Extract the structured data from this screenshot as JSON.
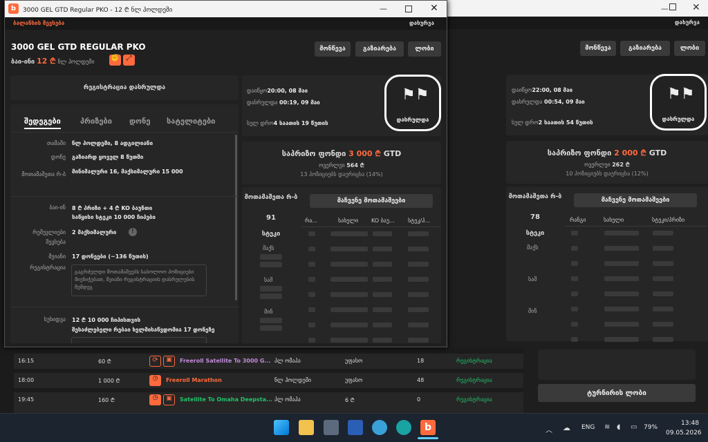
{
  "window": {
    "title": "3000 GEL GTD Regular PKO - 12 ₾ ნლ ჰოლდემი"
  },
  "back_window": {
    "close": "დახურვა",
    "buttons": [
      "მონწევა",
      "გაზიარება",
      "ლობი"
    ],
    "date_label": "დაიწყო",
    "date_value": "22:00, 08 მაი",
    "end_label": "დასრულდა",
    "end_value": "00:54, 09 მაი",
    "total_label": "სულ დრო",
    "total_value": "2 საათის 54 წუთის",
    "finished_badge": "დასრულდა",
    "prize_pool_label": "საპრიზო ფონდი",
    "prize_pool_value": "2 000 ₾",
    "prize_pool_suffix": "GTD",
    "overlay_label": "ოვერლეი",
    "overlay_value": "262 ₾",
    "overlay_note": "10 პოზიციებს დაერიცხა (12%)",
    "players_label": "მოთამაშეთა რ-ბ",
    "players_value": "78",
    "stack_label": "სტეკი",
    "show_players": "მაჩვენე მოთამაშეები",
    "cols": [
      "რანგი",
      "სახელი",
      "სტეკი/პრიზი"
    ],
    "stack_rows": [
      "მაქს",
      "საშ",
      "მინ"
    ],
    "lobby_button": "ტურნირის ლობი"
  },
  "front_window": {
    "balance": "ბალანსის შევსება",
    "close": "დახურვა",
    "title": "3000 GEL GTD REGULAR PKO",
    "buyin_label": "ბაი-ინი",
    "buyin_value": "12 ₾",
    "game_type": "ნლ ჰოლდემი",
    "buttons": [
      "მონწევა",
      "გაზიარება",
      "ლობი"
    ],
    "registration_closed": "რეგისტრაცია დასრულდა",
    "tabs": [
      "შედეგები",
      "პრიზები",
      "დონე",
      "სატელიტები"
    ],
    "info": [
      {
        "k": "თამაში",
        "v": "ნლ ჰოლდემი, 8 ადგილიანი"
      },
      {
        "k": "დონე",
        "v": "გაზიარდ ყოველ 8 წუთში"
      },
      {
        "k": "მოთამაშეთა რ-ბ",
        "v": "მინიმალური 16, მაქსიმალური 15 000"
      },
      {
        "k": "ბაი-ინ",
        "v": "8 ₾ პრიზი + 4 ₾ KO ბაუნთი"
      },
      {
        "k": "",
        "v": "საწყისი სტეკი 10 000 ჩიპები"
      },
      {
        "k": "რეშევლიები",
        "v": "2 მაქსიმალური"
      },
      {
        "k": "მეიანი",
        "v": "17 დონეები (~136 წუთის)"
      },
      {
        "k": "სუხიდვა",
        "v": "12 ₾ 10 000 ჩიპისთვის"
      }
    ],
    "rebuy_sub": "შევსება",
    "reg_label": "რეგისტრაცია",
    "late_reg_note": "გაგრძელდი მოთამაშეებს საბოლოო პოზიციები მიენიჭებათ, შეიანი რეგისტრაციის დასრულების შემდეგ",
    "rebuy_line": "შესაძლებელი რებაი ხელმისაწვდომია 17 დონეზე",
    "date_label": "დაიწყო",
    "date_value": "20:00, 08 მაი",
    "end_label": "დასრულდა",
    "end_value": "00:19, 09 მაი",
    "total_label": "სულ დრო",
    "total_value": "4 საათის 19 წუთის",
    "finished_badge": "დასრულდა",
    "prize_pool_label": "საპრიზო ფონდი",
    "prize_pool_value": "3 000 ₾",
    "prize_pool_suffix": "GTD",
    "overlay_label": "ოვერლეი",
    "overlay_value": "564 ₾",
    "overlay_note": "13 პოზიციებს დაერიცხა (14%)",
    "players_label": "მოთამაშეთა რ-ბ",
    "players_value": "91",
    "stack_label": "სტეკი",
    "show_players": "მაჩვენე მოთამაშეები",
    "cols": [
      "რა...",
      "სახელი",
      "KO ბაუ...",
      "სტეკ/პ..."
    ],
    "stack_rows": [
      "მაქს",
      "საშ",
      "მინ"
    ]
  },
  "lobby_rows": [
    {
      "time": "16:15",
      "buyin": "60 ₾",
      "name": "Freeroll Satellite To 3000 G...",
      "game": "პლ ომაჰა",
      "prize": "უფასო",
      "players": "18",
      "status": "რეგისტრაცია"
    },
    {
      "time": "18:00",
      "buyin": "1 000 ₾",
      "name": "Freeroll Marathon",
      "game": "ნლ ჰოლდემი",
      "prize": "უფასო",
      "players": "48",
      "status": "რეგისტრაცია"
    },
    {
      "time": "19:45",
      "buyin": "160 ₾",
      "name": "Satellite To Omaha Deepsta...",
      "game": "პლ ომაჰა",
      "prize": "6 ₾",
      "players": "0",
      "status": "რეგისტრაცია"
    }
  ],
  "taskbar": {
    "lang": "ENG",
    "battery": "79%",
    "time": "13:48",
    "date": "09.05.2026"
  },
  "colors": {
    "accent": "#ff6a3d",
    "green": "#21c36b"
  }
}
